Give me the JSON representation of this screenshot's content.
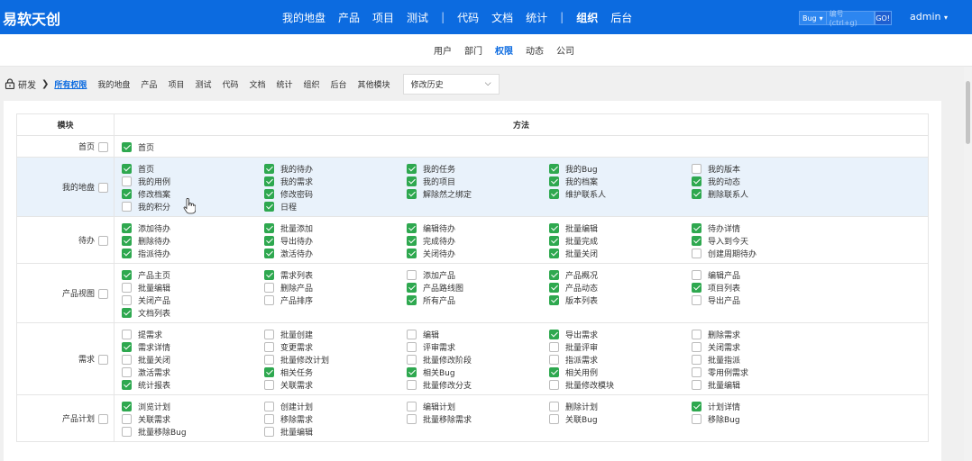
{
  "app": {
    "brand": "易软天创"
  },
  "main_nav": {
    "items": [
      "我的地盘",
      "产品",
      "项目",
      "测试",
      "|",
      "代码",
      "文档",
      "统计",
      "|",
      "组织",
      "后台"
    ],
    "active": "组织"
  },
  "search": {
    "type": "Bug",
    "placeholder": "编号(ctrl+g)",
    "go": "GO!"
  },
  "user": {
    "name": "admin"
  },
  "sub_nav": {
    "items": [
      "用户",
      "部门",
      "权限",
      "动态",
      "公司"
    ],
    "active": "权限"
  },
  "toolbar": {
    "breadcrumb": "研发",
    "items": [
      "所有权限",
      "我的地盘",
      "产品",
      "项目",
      "测试",
      "代码",
      "文档",
      "统计",
      "组织",
      "后台",
      "其他模块"
    ],
    "active": "所有权限",
    "history_select": "修改历史"
  },
  "table": {
    "header_module": "模块",
    "header_methods": "方法",
    "rows": [
      {
        "module": "首页",
        "methods": [
          [
            "首页",
            true
          ]
        ]
      },
      {
        "module": "我的地盘",
        "highlight": true,
        "methods": [
          [
            "首页",
            true
          ],
          [
            "我的待办",
            true
          ],
          [
            "我的任务",
            true
          ],
          [
            "我的Bug",
            true
          ],
          [
            "我的版本",
            false
          ],
          [
            "我的用例",
            false
          ],
          [
            "我的需求",
            true
          ],
          [
            "我的项目",
            true
          ],
          [
            "我的档案",
            true
          ],
          [
            "我的动态",
            true
          ],
          [
            "修改档案",
            true
          ],
          [
            "修改密码",
            true
          ],
          [
            "解除然之绑定",
            true
          ],
          [
            "维护联系人",
            true
          ],
          [
            "删除联系人",
            true
          ],
          [
            "我的积分",
            false
          ],
          [
            "日程",
            true
          ]
        ]
      },
      {
        "module": "待办",
        "methods": [
          [
            "添加待办",
            true
          ],
          [
            "批量添加",
            true
          ],
          [
            "编辑待办",
            true
          ],
          [
            "批量编辑",
            true
          ],
          [
            "待办详情",
            true
          ],
          [
            "删除待办",
            true
          ],
          [
            "导出待办",
            true
          ],
          [
            "完成待办",
            true
          ],
          [
            "批量完成",
            true
          ],
          [
            "导入到今天",
            true
          ],
          [
            "指派待办",
            true
          ],
          [
            "激活待办",
            true
          ],
          [
            "关闭待办",
            true
          ],
          [
            "批量关闭",
            true
          ],
          [
            "创建周期待办",
            false
          ]
        ]
      },
      {
        "module": "产品视图",
        "methods": [
          [
            "产品主页",
            true
          ],
          [
            "需求列表",
            true
          ],
          [
            "添加产品",
            false
          ],
          [
            "产品概况",
            true
          ],
          [
            "编辑产品",
            false
          ],
          [
            "批量编辑",
            false
          ],
          [
            "删除产品",
            false
          ],
          [
            "产品路线图",
            true
          ],
          [
            "产品动态",
            true
          ],
          [
            "项目列表",
            true
          ],
          [
            "关闭产品",
            false
          ],
          [
            "产品排序",
            false
          ],
          [
            "所有产品",
            true
          ],
          [
            "版本列表",
            true
          ],
          [
            "导出产品",
            false
          ],
          [
            "文档列表",
            true
          ]
        ]
      },
      {
        "module": "需求",
        "methods": [
          [
            "提需求",
            false
          ],
          [
            "批量创建",
            false
          ],
          [
            "编辑",
            false
          ],
          [
            "导出需求",
            true
          ],
          [
            "删除需求",
            false
          ],
          [
            "需求详情",
            true
          ],
          [
            "变更需求",
            false
          ],
          [
            "评审需求",
            false
          ],
          [
            "批量评审",
            false
          ],
          [
            "关闭需求",
            false
          ],
          [
            "批量关闭",
            false
          ],
          [
            "批量修改计划",
            false
          ],
          [
            "批量修改阶段",
            false
          ],
          [
            "指派需求",
            false
          ],
          [
            "批量指派",
            false
          ],
          [
            "激活需求",
            false
          ],
          [
            "相关任务",
            true
          ],
          [
            "相关Bug",
            true
          ],
          [
            "相关用例",
            true
          ],
          [
            "零用例需求",
            false
          ],
          [
            "统计报表",
            true
          ],
          [
            "关联需求",
            false
          ],
          [
            "批量修改分支",
            false
          ],
          [
            "批量修改模块",
            false
          ],
          [
            "批量编辑",
            false
          ]
        ]
      },
      {
        "module": "产品计划",
        "methods": [
          [
            "浏览计划",
            true
          ],
          [
            "创建计划",
            false
          ],
          [
            "编辑计划",
            false
          ],
          [
            "删除计划",
            false
          ],
          [
            "计划详情",
            true
          ],
          [
            "关联需求",
            false
          ],
          [
            "移除需求",
            false
          ],
          [
            "批量移除需求",
            false
          ],
          [
            "关联Bug",
            false
          ],
          [
            "移除Bug",
            false
          ],
          [
            "批量移除Bug",
            false
          ],
          [
            "批量编辑",
            false
          ]
        ]
      }
    ]
  },
  "colors": {
    "primary": "#0c6be0",
    "checked": "#2ea84f",
    "highlight_row": "#e9f2fb"
  }
}
